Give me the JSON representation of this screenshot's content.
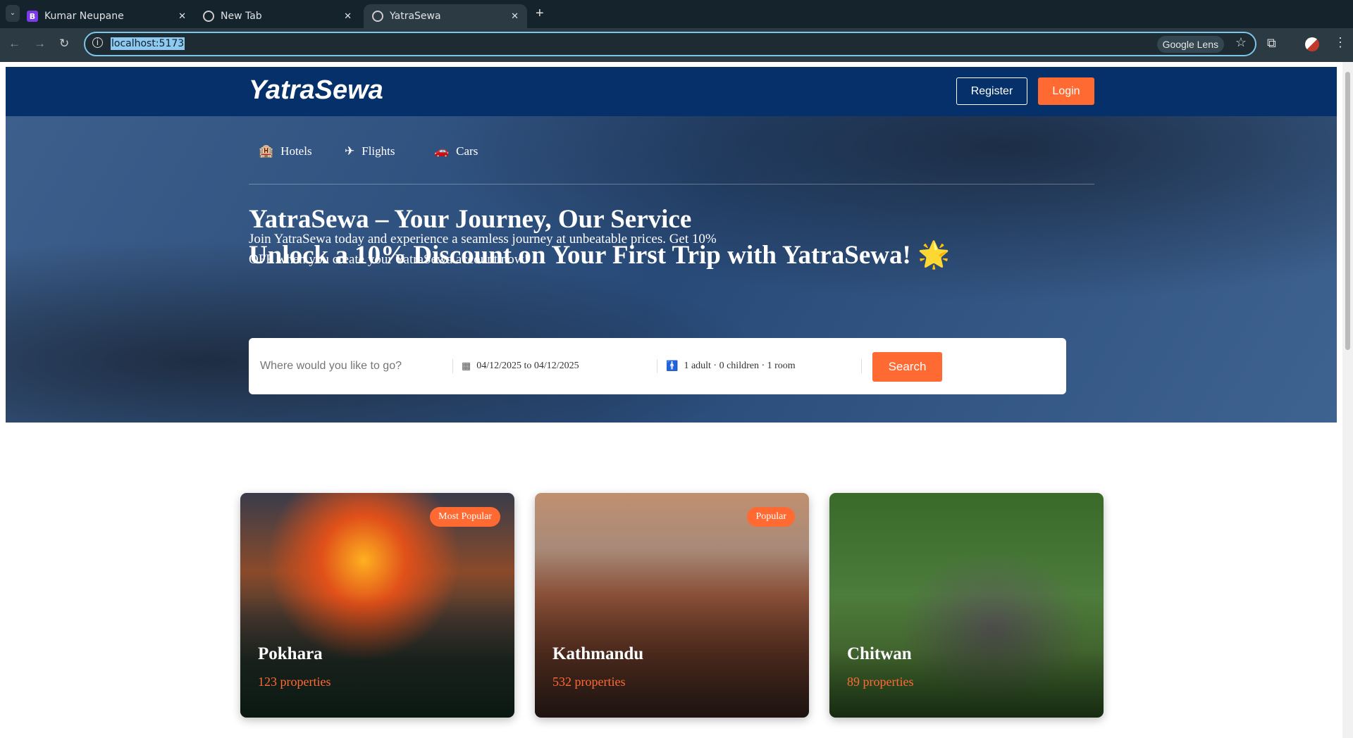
{
  "browser": {
    "tabs": [
      {
        "title": "Kumar Neupane",
        "icon": "B"
      },
      {
        "title": "New Tab"
      },
      {
        "title": "YatraSewa",
        "active": true
      }
    ],
    "url": "localhost:5173",
    "lens": "Google Lens"
  },
  "header": {
    "logo": "YatraSewa",
    "register": "Register",
    "login": "Login"
  },
  "nav": [
    {
      "label": "Hotels",
      "icon": "hotel-icon"
    },
    {
      "label": "Flights",
      "icon": "plane-icon"
    },
    {
      "label": "Cars",
      "icon": "car-icon"
    }
  ],
  "hero": {
    "title": "YatraSewa – Your Journey, Our Service",
    "subtitle": "Unlock a 10% Discount on Your First Trip with YatraSewa! 🌟",
    "description": "Join YatraSewa today and experience a seamless journey at unbeatable prices. Get 10% OFF when you create your YatraSewa account now!"
  },
  "search": {
    "placeholder": "Where would you like to go?",
    "dates": "04/12/2025 to 04/12/2025",
    "guests": "1 adult · 0 children · 1 room",
    "button": "Search"
  },
  "destinations": [
    {
      "name": "Pokhara",
      "properties": "123 properties",
      "badge": "Most Popular"
    },
    {
      "name": "Kathmandu",
      "properties": "532 properties",
      "badge": "Popular"
    },
    {
      "name": "Chitwan",
      "properties": "89 properties"
    }
  ],
  "colors": {
    "accent": "#ff6a33",
    "navy": "#06306a"
  }
}
